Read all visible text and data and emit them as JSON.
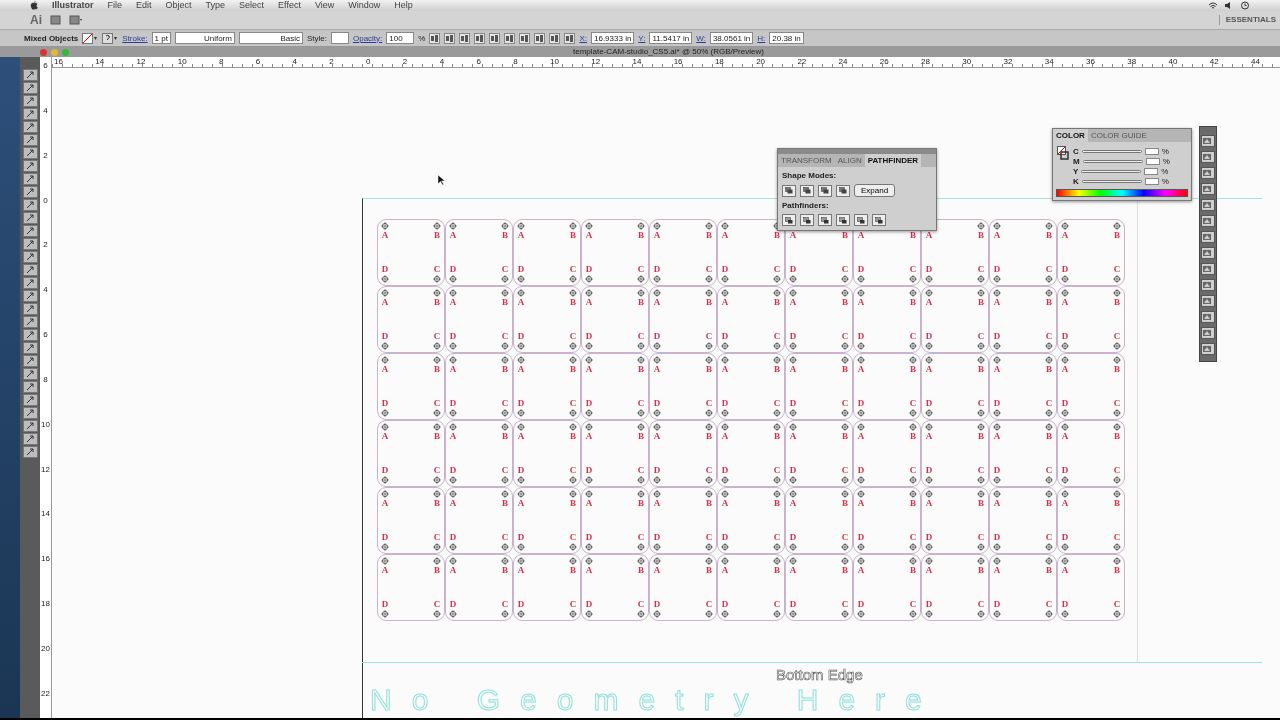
{
  "menu_bar": {
    "items": [
      "Illustrator",
      "File",
      "Edit",
      "Object",
      "Type",
      "Select",
      "Effect",
      "View",
      "Window",
      "Help"
    ]
  },
  "app_bar": {
    "logo": "Ai",
    "workspace": "ESSENTIALS"
  },
  "control_bar": {
    "selection": "Mixed Objects",
    "stroke_label": "Stroke:",
    "stroke_weight": "1 pt",
    "profile": "Uniform",
    "brush": "Basic",
    "style_label": "Style:",
    "opacity_label": "Opacity:",
    "opacity": "100",
    "opacity_unit": "%",
    "fields": [
      {
        "label": "X:",
        "value": "16.9333 in"
      },
      {
        "label": "Y:",
        "value": "11.5417 in"
      },
      {
        "label": "W:",
        "value": "38.0561 in"
      },
      {
        "label": "H:",
        "value": "20.38 in"
      }
    ]
  },
  "document_tab": {
    "title": "template-CAM-studio_CS5.ai* @ 50% (RGB/Preview)"
  },
  "rulers": {
    "horizontal": [
      "16",
      "14",
      "12",
      "10",
      "8",
      "6",
      "4",
      "2",
      "0",
      "2",
      "4",
      "6",
      "8",
      "10",
      "12",
      "14",
      "16",
      "18",
      "20",
      "22",
      "24",
      "26",
      "28",
      "30",
      "32",
      "34",
      "36",
      "38",
      "40",
      "42",
      "44"
    ],
    "vertical": [
      "6",
      "4",
      "2",
      "0",
      "2",
      "4",
      "6",
      "8",
      "10",
      "12",
      "14",
      "16",
      "18",
      "20",
      "22"
    ]
  },
  "pathfinder_panel": {
    "tabs": [
      {
        "label": "TRANSFORM",
        "selected": false
      },
      {
        "label": "ALIGN",
        "selected": false
      },
      {
        "label": "PATHFINDER",
        "selected": true
      }
    ],
    "shape_modes_label": "Shape Modes:",
    "expand_button": "Expand",
    "pathfinders_label": "Pathfinders:"
  },
  "color_panel": {
    "tabs": [
      {
        "label": "COLOR",
        "selected": true
      },
      {
        "label": "COLOR GUIDE",
        "selected": false
      }
    ],
    "channels": [
      {
        "name": "C",
        "unit": "%"
      },
      {
        "name": "M",
        "unit": "%"
      },
      {
        "name": "Y",
        "unit": "%"
      },
      {
        "name": "K",
        "unit": "%"
      }
    ]
  },
  "artboard": {
    "bottom_label": "Bottom Edge",
    "background_text": "No Geometry Here",
    "tile_rows": [
      [
        {
          "corners": [
            "A",
            "B",
            "D",
            "C"
          ]
        },
        {
          "corners": [
            "A",
            "B",
            "D",
            "C"
          ]
        },
        {
          "corners": [
            "A",
            "B",
            "D",
            "C"
          ]
        },
        {
          "corners": [
            "A",
            "B",
            "D",
            "C"
          ]
        },
        {
          "corners": [
            "A",
            "B",
            "D",
            "C"
          ]
        },
        {
          "corners": [
            "A",
            "B",
            "D",
            "C"
          ]
        },
        {
          "corners": [
            "A",
            "B",
            "D",
            "C"
          ]
        },
        {
          "corners": [
            "A",
            "B",
            "D",
            "C"
          ]
        },
        {
          "corners": [
            "A",
            "B",
            "D",
            "C"
          ]
        },
        {
          "corners": [
            "A",
            "B",
            "D",
            "C"
          ]
        },
        {
          "corners": [
            "A",
            "B",
            "D",
            "C"
          ]
        }
      ],
      [
        {
          "corners": [
            "A",
            "B",
            "D",
            "C"
          ]
        },
        {
          "corners": [
            "A",
            "B",
            "D",
            "C"
          ]
        },
        {
          "corners": [
            "A",
            "B",
            "D",
            "C"
          ]
        },
        {
          "corners": [
            "A",
            "B",
            "D",
            "C"
          ]
        },
        {
          "corners": [
            "A",
            "B",
            "D",
            "C"
          ]
        },
        {
          "corners": [
            "A",
            "B",
            "D",
            "C"
          ]
        },
        {
          "corners": [
            "A",
            "B",
            "D",
            "C"
          ]
        },
        {
          "corners": [
            "A",
            "B",
            "D",
            "C"
          ]
        },
        {
          "corners": [
            "A",
            "B",
            "D",
            "C"
          ]
        },
        {
          "corners": [
            "A",
            "B",
            "D",
            "C"
          ]
        },
        {
          "corners": [
            "A",
            "B",
            "D",
            "C"
          ]
        }
      ],
      [
        {
          "corners": [
            "A",
            "B",
            "D",
            "C"
          ]
        },
        {
          "corners": [
            "A",
            "B",
            "D",
            "C"
          ]
        },
        {
          "corners": [
            "A",
            "B",
            "D",
            "C"
          ]
        },
        {
          "corners": [
            "A",
            "B",
            "D",
            "C"
          ]
        },
        {
          "corners": [
            "A",
            "B",
            "D",
            "C"
          ]
        },
        {
          "corners": [
            "A",
            "B",
            "D",
            "C"
          ]
        },
        {
          "corners": [
            "A",
            "B",
            "D",
            "C"
          ]
        },
        {
          "corners": [
            "A",
            "B",
            "D",
            "C"
          ]
        },
        {
          "corners": [
            "A",
            "B",
            "D",
            "C"
          ]
        },
        {
          "corners": [
            "A",
            "B",
            "D",
            "C"
          ]
        },
        {
          "corners": [
            "A",
            "B",
            "D",
            "C"
          ]
        }
      ],
      [
        {
          "corners": [
            "A",
            "B",
            "D",
            "C"
          ]
        },
        {
          "corners": [
            "A",
            "B",
            "D",
            "C"
          ]
        },
        {
          "corners": [
            "A",
            "B",
            "D",
            "C"
          ]
        },
        {
          "corners": [
            "A",
            "B",
            "D",
            "C"
          ]
        },
        {
          "corners": [
            "A",
            "B",
            "D",
            "C"
          ]
        },
        {
          "corners": [
            "A",
            "B",
            "D",
            "C"
          ]
        },
        {
          "corners": [
            "A",
            "B",
            "D",
            "C"
          ]
        },
        {
          "corners": [
            "A",
            "B",
            "D",
            "C"
          ]
        },
        {
          "corners": [
            "A",
            "B",
            "D",
            "C"
          ]
        },
        {
          "corners": [
            "A",
            "B",
            "D",
            "C"
          ]
        },
        {
          "corners": [
            "A",
            "B",
            "D",
            "C"
          ]
        }
      ],
      [
        {
          "corners": [
            "A",
            "B",
            "D",
            "C"
          ]
        },
        {
          "corners": [
            "A",
            "B",
            "D",
            "C"
          ]
        },
        {
          "corners": [
            "A",
            "B",
            "D",
            "C"
          ]
        },
        {
          "corners": [
            "A",
            "B",
            "D",
            "C"
          ]
        },
        {
          "corners": [
            "A",
            "B",
            "D",
            "C"
          ]
        },
        {
          "corners": [
            "A",
            "B",
            "D",
            "C"
          ]
        },
        {
          "corners": [
            "A",
            "B",
            "D",
            "C"
          ]
        },
        {
          "corners": [
            "A",
            "B",
            "D",
            "C"
          ]
        },
        {
          "corners": [
            "A",
            "B",
            "D",
            "C"
          ]
        },
        {
          "corners": [
            "A",
            "B",
            "D",
            "C"
          ]
        },
        {
          "corners": [
            "A",
            "B",
            "D",
            "C"
          ]
        }
      ],
      [
        {
          "corners": [
            "A",
            "B",
            "D",
            "C"
          ]
        },
        {
          "corners": [
            "A",
            "B",
            "D",
            "C"
          ]
        },
        {
          "corners": [
            "A",
            "B",
            "D",
            "C"
          ]
        },
        {
          "corners": [
            "A",
            "B",
            "D",
            "C"
          ]
        },
        {
          "corners": [
            "A",
            "B",
            "D",
            "C"
          ]
        },
        {
          "corners": [
            "A",
            "B",
            "D",
            "C"
          ]
        },
        {
          "corners": [
            "A",
            "B",
            "D",
            "C"
          ]
        },
        {
          "corners": [
            "A",
            "B",
            "D",
            "C"
          ]
        },
        {
          "corners": [
            "A",
            "B",
            "D",
            "C"
          ]
        },
        {
          "corners": [
            "A",
            "B",
            "D",
            "C"
          ]
        },
        {
          "corners": [
            "A",
            "B",
            "D",
            "C"
          ]
        }
      ]
    ]
  }
}
